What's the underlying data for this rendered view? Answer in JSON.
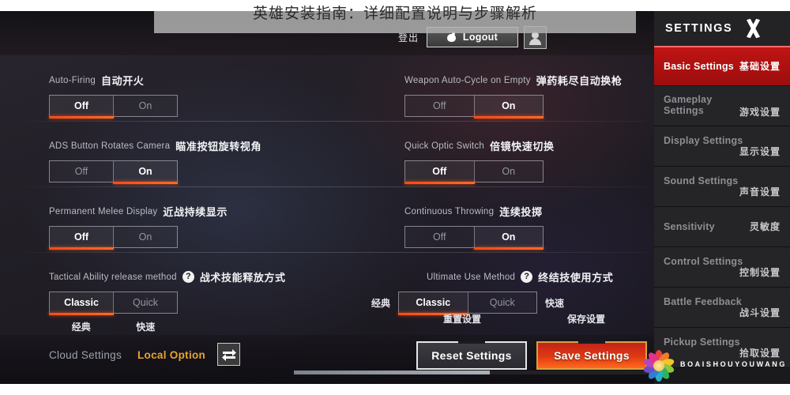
{
  "overlay": {
    "title": "英雄安装指南：详细配置说明与步骤解析"
  },
  "topbar": {
    "logout_cn": "登出",
    "logout_label": "Logout",
    "logout_icon": "apple-icon",
    "avatar_icon": "user-avatar-icon"
  },
  "settings_rows": [
    {
      "left": {
        "en": "Auto-Firing",
        "cn": "自动开火",
        "has_help": false,
        "options": [
          "Off",
          "On"
        ],
        "selected": 0
      },
      "right": {
        "en": "Weapon Auto-Cycle on Empty",
        "cn": "弹药耗尽自动换枪",
        "has_help": false,
        "options": [
          "Off",
          "On"
        ],
        "selected": 1
      }
    },
    {
      "left": {
        "en": "ADS Button Rotates Camera",
        "cn": "瞄准按钮旋转视角",
        "has_help": false,
        "options": [
          "Off",
          "On"
        ],
        "selected": 1
      },
      "right": {
        "en": "Quick Optic Switch",
        "cn": "倍镜快速切换",
        "has_help": false,
        "options": [
          "Off",
          "On"
        ],
        "selected": 0
      }
    },
    {
      "left": {
        "en": "Permanent Melee Display",
        "cn": "近战持续显示",
        "has_help": false,
        "options": [
          "Off",
          "On"
        ],
        "selected": 0
      },
      "right": {
        "en": "Continuous Throwing",
        "cn": "连续投掷",
        "has_help": false,
        "options": [
          "Off",
          "On"
        ],
        "selected": 1
      }
    },
    {
      "left": {
        "en": "Tactical Ability release method",
        "cn": "战术技能释放方式",
        "has_help": true,
        "help_icon": "question-mark-icon",
        "options": [
          "Classic",
          "Quick"
        ],
        "options_cn": [
          "经典",
          "快速"
        ],
        "selected": 0
      },
      "right": {
        "en": "Ultimate Use Method",
        "cn": "终结技使用方式",
        "has_help": true,
        "help_icon": "question-mark-icon",
        "options": [
          "Classic",
          "Quick"
        ],
        "flank_left_cn": "经典",
        "flank_right_cn": "快速",
        "selected": 0
      }
    }
  ],
  "bottombar": {
    "cloud_settings": "Cloud Settings",
    "local_option": "Local Option",
    "swap_icon": "swap-arrows-icon",
    "reset_button": "Reset Settings",
    "reset_button_cn": "重置设置",
    "save_button": "Save Settings",
    "save_button_cn": "保存设置"
  },
  "sidebar": {
    "title": "SETTINGS",
    "close_icon": "x-close-icon",
    "items": [
      {
        "en": "Basic Settings",
        "cn": "基础设置",
        "active": true,
        "inline": true
      },
      {
        "en": "Gameplay Settings",
        "cn": "游戏设置",
        "active": false,
        "inline": false
      },
      {
        "en": "Display Settings",
        "cn": "显示设置",
        "active": false,
        "inline": false
      },
      {
        "en": "Sound Settings",
        "cn": "声音设置",
        "active": false,
        "inline": false
      },
      {
        "en": "Sensitivity",
        "cn": "灵敏度",
        "active": false,
        "inline": true
      },
      {
        "en": "Control Settings",
        "cn": "控制设置",
        "active": false,
        "inline": false
      },
      {
        "en": "Battle Feedback",
        "cn": "战斗设置",
        "active": false,
        "inline": false
      },
      {
        "en": "Pickup Settings",
        "cn": "拾取设置",
        "active": false,
        "inline": false
      }
    ]
  },
  "watermark": {
    "text": "BOAISHOUYOUWANG",
    "icon": "flower-logo-icon"
  },
  "colors": {
    "accent_red": "#ff4a16",
    "active_nav": "#c01414",
    "local_option_gold": "#e8a333",
    "save_border_gold": "#d9a23e"
  }
}
